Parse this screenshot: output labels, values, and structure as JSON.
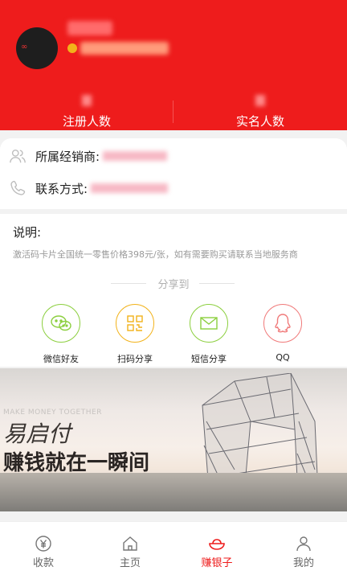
{
  "stats": {
    "registered_label": "注册人数",
    "verified_label": "实名人数"
  },
  "dealer": {
    "belong_label": "所属经销商:",
    "contact_label": "联系方式:"
  },
  "explain": {
    "title": "说明:",
    "desc": "激活码卡片全国统一零售价格398元/张，如有需要购买请联系当地服务商"
  },
  "share": {
    "heading": "分享到",
    "items": [
      {
        "label": "微信好友",
        "icon": "wechat-icon"
      },
      {
        "label": "扫码分享",
        "icon": "qrcode-icon"
      },
      {
        "label": "短信分享",
        "icon": "mail-icon"
      },
      {
        "label": "QQ",
        "icon": "qq-icon"
      }
    ]
  },
  "banner": {
    "make_money": "MAKE MONEY TOGETHER",
    "brand": "易启付",
    "slogan": "赚钱就在一瞬间"
  },
  "nav": {
    "items": [
      {
        "label": "收款",
        "icon": "yen-icon"
      },
      {
        "label": "主页",
        "icon": "home-icon"
      },
      {
        "label": "赚银子",
        "icon": "ingot-icon",
        "active": true
      },
      {
        "label": "我的",
        "icon": "user-icon"
      }
    ]
  },
  "colors": {
    "primary": "#ee1c1c",
    "share_green": "#8ccf3f",
    "share_yellow": "#f2b21a",
    "share_red": "#f07a7a"
  }
}
